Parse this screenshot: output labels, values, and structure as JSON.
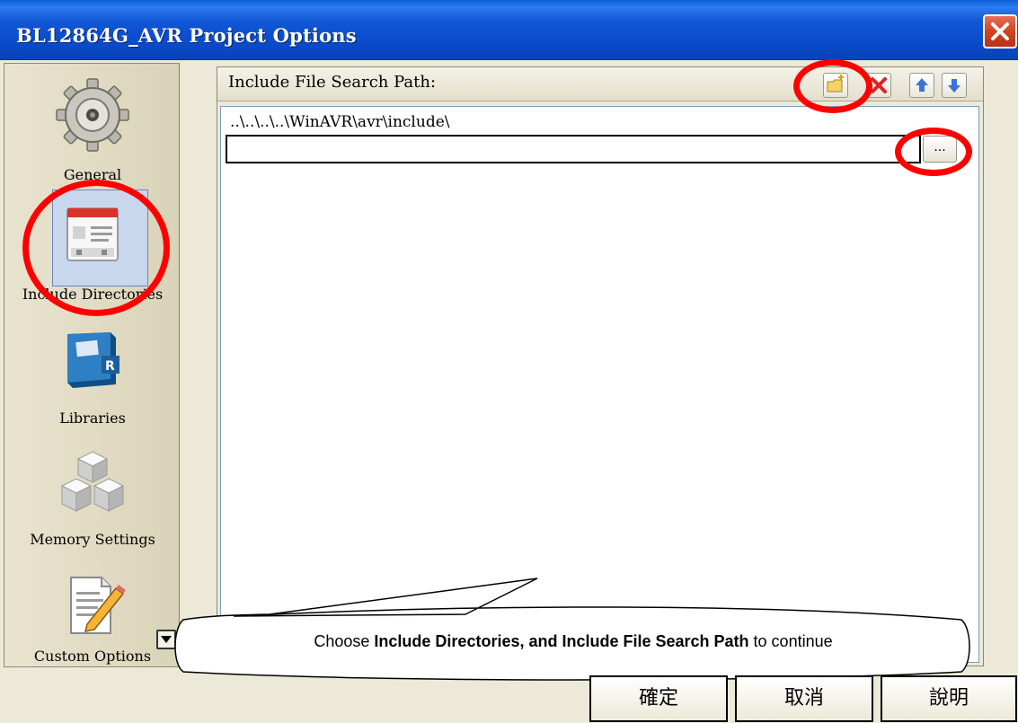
{
  "window": {
    "title": "BL12864G_AVR Project Options"
  },
  "sidebar": {
    "items": [
      {
        "label": "General",
        "icon": "gear-icon"
      },
      {
        "label": "Include Directories",
        "icon": "include-directories-icon"
      },
      {
        "label": "Libraries",
        "icon": "libraries-book-icon"
      },
      {
        "label": "Memory Settings",
        "icon": "memory-cubes-icon"
      },
      {
        "label": "Custom Options",
        "icon": "custom-options-pencil-icon"
      }
    ]
  },
  "panel": {
    "header_label": "Include File Search Path:",
    "toolbar": [
      "new-folder-icon",
      "delete-icon",
      "move-up-icon",
      "move-down-icon"
    ],
    "paths": [
      "..\\..\\..\\..\\WinAVR\\avr\\include\\"
    ],
    "edit_value": "",
    "browse_label": "..."
  },
  "buttons": {
    "ok": "確定",
    "cancel": "取消",
    "help": "說明"
  },
  "callout": {
    "prefix": "Choose ",
    "bold": "Include Directories, and Include File Search Path",
    "suffix": " to continue"
  },
  "colors": {
    "titlebar": "#0a4ccb",
    "annotation": "#ff0000",
    "selection": "#c8d6ee"
  }
}
